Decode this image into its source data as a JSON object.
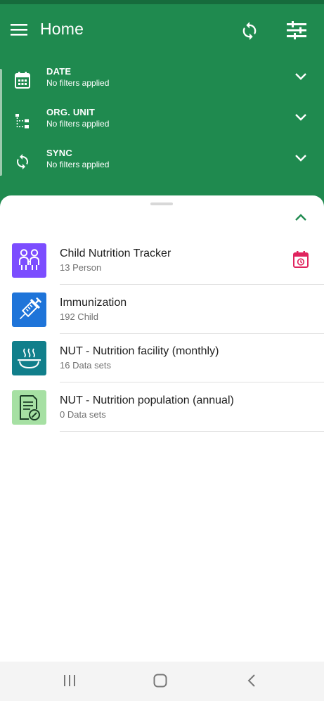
{
  "appbar": {
    "title": "Home",
    "menu_icon": "menu-icon",
    "sync_icon": "sync-icon",
    "filter_icon": "tune-icon"
  },
  "filters": [
    {
      "name": "DATE",
      "status": "No filters applied",
      "icon": "calendar-icon"
    },
    {
      "name": "ORG. UNIT",
      "status": "No filters applied",
      "icon": "org-tree-icon"
    },
    {
      "name": "SYNC",
      "status": "No filters applied",
      "icon": "sync-icon"
    }
  ],
  "programs": [
    {
      "name": "Child Nutrition Tracker",
      "count": "13 Person",
      "icon": "children-icon",
      "color": "#7c4dff",
      "has_calendar": true
    },
    {
      "name": "Immunization",
      "count": "192 Child",
      "icon": "syringe-icon",
      "color": "#1e74d9"
    },
    {
      "name": "NUT - Nutrition facility (monthly)",
      "count": "16 Data sets",
      "icon": "hot-food-icon",
      "color": "#117f8b"
    },
    {
      "name": "NUT - Nutrition population (annual)",
      "count": "0 Data sets",
      "icon": "document-icon",
      "color": "#a6e0a3"
    }
  ],
  "colors": {
    "primary": "#1f8a4f",
    "calendar_accent": "#e0245e"
  }
}
